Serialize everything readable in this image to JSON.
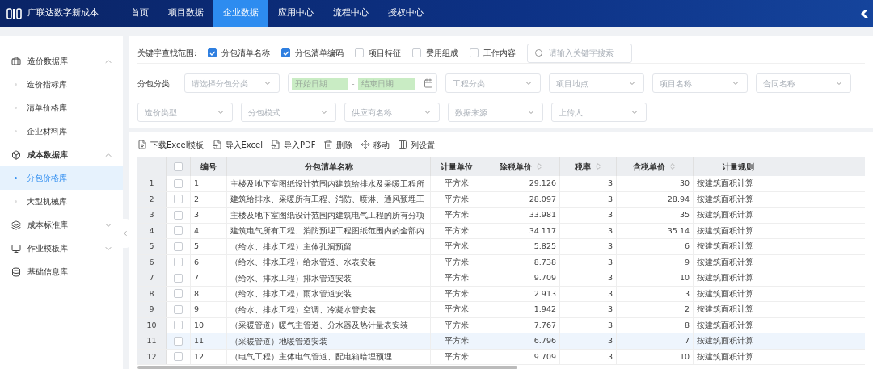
{
  "app": {
    "title": "广联达数字新成本"
  },
  "nav": [
    {
      "label": "首页",
      "selected": false
    },
    {
      "label": "项目数据",
      "selected": false
    },
    {
      "label": "企业数据",
      "selected": true
    },
    {
      "label": "应用中心",
      "selected": false
    },
    {
      "label": "流程中心",
      "selected": false
    },
    {
      "label": "授权中心",
      "selected": false
    }
  ],
  "sidebar": [
    {
      "label": "造价数据库",
      "expanded": true,
      "children": [
        {
          "label": "造价指标库",
          "selected": false
        },
        {
          "label": "清单价格库",
          "selected": false
        },
        {
          "label": "企业材料库",
          "selected": false
        }
      ]
    },
    {
      "label": "成本数据库",
      "expanded": true,
      "children": [
        {
          "label": "分包价格库",
          "selected": true
        },
        {
          "label": "大型机械库",
          "selected": false
        }
      ]
    },
    {
      "label": "成本标准库",
      "expanded": false
    },
    {
      "label": "作业模板库",
      "expanded": false
    },
    {
      "label": "基础信息库"
    }
  ],
  "keyword_scope": {
    "label": "关键字查找范围:",
    "options": [
      {
        "label": "分包清单名称",
        "checked": true
      },
      {
        "label": "分包清单编码",
        "checked": true
      },
      {
        "label": "项目特征",
        "checked": false
      },
      {
        "label": "费用组成",
        "checked": false
      },
      {
        "label": "工作内容",
        "checked": false
      }
    ],
    "search": {
      "placeholder": "请输入关键字搜索"
    }
  },
  "filters": [
    [
      {
        "kind": "label",
        "text": "分包分类"
      },
      {
        "kind": "select",
        "placeholder": "请选择分包分类"
      },
      {
        "kind": "date_range",
        "start": "开始日期",
        "separator": "-",
        "end": "结束日期"
      },
      {
        "kind": "select",
        "placeholder": "工程分类"
      },
      {
        "kind": "select",
        "placeholder": "项目地点"
      },
      {
        "kind": "select",
        "placeholder": "项目名称"
      },
      {
        "kind": "select",
        "placeholder": "合同名称"
      }
    ],
    [
      {
        "kind": "select",
        "placeholder": "造价类型"
      },
      {
        "kind": "select",
        "placeholder": "分包模式"
      },
      {
        "kind": "select",
        "placeholder": "供应商名称"
      },
      {
        "kind": "select",
        "placeholder": "数据来源"
      },
      {
        "kind": "select",
        "placeholder": "上传人"
      }
    ]
  ],
  "toolbar": [
    {
      "label": "下载Excel模板",
      "kind": "download"
    },
    {
      "label": "导入Excel",
      "kind": "import"
    },
    {
      "label": "导入PDF",
      "kind": "import"
    },
    {
      "label": "删除",
      "kind": "delete"
    },
    {
      "label": "移动",
      "kind": "move"
    },
    {
      "label": "列设置",
      "kind": "columns"
    }
  ],
  "table": {
    "columns": [
      {
        "label": "编号",
        "sortable": false,
        "kind": "text"
      },
      {
        "label": "分包清单名称",
        "sortable": false,
        "kind": "text"
      },
      {
        "label": "计量单位",
        "sortable": false,
        "kind": "center"
      },
      {
        "label": "除税单价",
        "sortable": true,
        "kind": "number"
      },
      {
        "label": "税率",
        "sortable": true,
        "kind": "number"
      },
      {
        "label": "含税单价",
        "sortable": true,
        "kind": "number"
      },
      {
        "label": "计量规则",
        "sortable": false,
        "kind": "text"
      }
    ],
    "header_checked": false,
    "rows": [
      {
        "index": "1",
        "checked": false,
        "highlighted": false,
        "cells": [
          "1",
          "主楼及地下室图纸设计范围内建筑给排水及采暖工程所",
          "平方米",
          "29.126",
          "3",
          "30",
          "按建筑面积计算"
        ]
      },
      {
        "index": "2",
        "checked": false,
        "highlighted": false,
        "cells": [
          "2",
          "建筑给排水、采暖所有工程、消防、喷淋、通风预埋工",
          "平方米",
          "28.097",
          "3",
          "28.94",
          "按建筑面积计算"
        ]
      },
      {
        "index": "3",
        "checked": false,
        "highlighted": false,
        "cells": [
          "3",
          "主楼及地下室图纸设计范围内建筑电气工程的所有分项",
          "平方米",
          "33.981",
          "3",
          "35",
          "按建筑面积计算"
        ]
      },
      {
        "index": "4",
        "checked": false,
        "highlighted": false,
        "cells": [
          "4",
          "建筑电气所有工程、消防预埋工程图纸范围内的全部内",
          "平方米",
          "34.117",
          "3",
          "35.14",
          "按建筑面积计算"
        ]
      },
      {
        "index": "5",
        "checked": false,
        "highlighted": false,
        "cells": [
          "5",
          "（给水、排水工程）主体孔洞预留",
          "平方米",
          "5.825",
          "3",
          "6",
          "按建筑面积计算"
        ]
      },
      {
        "index": "6",
        "checked": false,
        "highlighted": false,
        "cells": [
          "6",
          "（给水、排水工程）给水管道、水表安装",
          "平方米",
          "8.738",
          "3",
          "9",
          "按建筑面积计算"
        ]
      },
      {
        "index": "7",
        "checked": false,
        "highlighted": false,
        "cells": [
          "7",
          "（给水、排水工程）排水管道安装",
          "平方米",
          "9.709",
          "3",
          "10",
          "按建筑面积计算"
        ]
      },
      {
        "index": "8",
        "checked": false,
        "highlighted": false,
        "cells": [
          "8",
          "（给水、排水工程）雨水管道安装",
          "平方米",
          "2.913",
          "3",
          "3",
          "按建筑面积计算"
        ]
      },
      {
        "index": "9",
        "checked": false,
        "highlighted": false,
        "cells": [
          "9",
          "（给水、排水工程）空调、冷凝水管安装",
          "平方米",
          "1.942",
          "3",
          "2",
          "按建筑面积计算"
        ]
      },
      {
        "index": "10",
        "checked": false,
        "highlighted": false,
        "cells": [
          "10",
          "（采暖管道）暖气主管道、分水器及热计量表安装",
          "平方米",
          "7.767",
          "3",
          "8",
          "按建筑面积计算"
        ]
      },
      {
        "index": "11",
        "checked": false,
        "highlighted": true,
        "cells": [
          "11",
          "（采暖管道）地暖管道安装",
          "平方米",
          "6.796",
          "3",
          "7",
          "按建筑面积计算"
        ]
      },
      {
        "index": "12",
        "checked": false,
        "highlighted": false,
        "cells": [
          "12",
          "（电气工程）主体电气管道、配电箱暗埋预埋",
          "平方米",
          "9.709",
          "3",
          "10",
          "按建筑面积计算"
        ]
      }
    ]
  }
}
